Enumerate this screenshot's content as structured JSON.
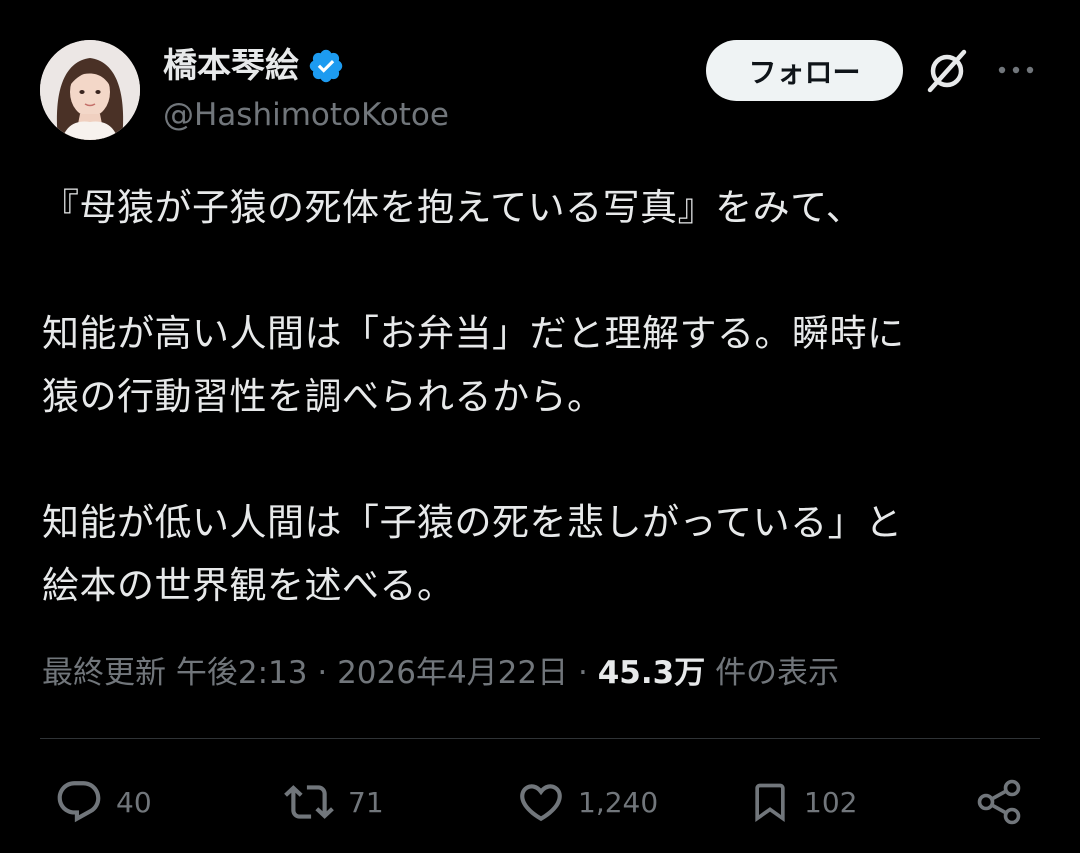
{
  "author": {
    "display_name": "橋本琴絵",
    "handle": "@HashimotoKotoe",
    "verified": true
  },
  "header": {
    "follow_label": "フォロー"
  },
  "tweet": {
    "paragraphs": [
      [
        "『母猿が子猿の死体を抱えている写真』をみて、"
      ],
      [
        "知能が高い人間は「お弁当」だと理解する。瞬時に",
        "猿の行動習性を調べられるから。"
      ],
      [
        "知能が低い人間は「子猿の死を悲しがっている」と",
        "絵本の世界観を述べる。"
      ]
    ]
  },
  "meta": {
    "edited_label": "最終更新",
    "time": "午後2:13",
    "date": "2026年4月22日",
    "separator": "·",
    "views_count": "45.3万",
    "views_label": "件の表示"
  },
  "actions": {
    "reply_count": "40",
    "repost_count": "71",
    "like_count": "1,240",
    "bookmark_count": "102"
  },
  "colors": {
    "background": "#000000",
    "text_primary": "#e7e9ea",
    "text_secondary": "#71767b",
    "verified_blue": "#1d9bf0",
    "follow_bg": "#eff3f4",
    "divider": "#2f3336"
  },
  "icons": [
    "verified-badge-icon",
    "grok-icon",
    "more-icon",
    "reply-icon",
    "repost-icon",
    "like-icon",
    "bookmark-icon",
    "share-icon"
  ]
}
